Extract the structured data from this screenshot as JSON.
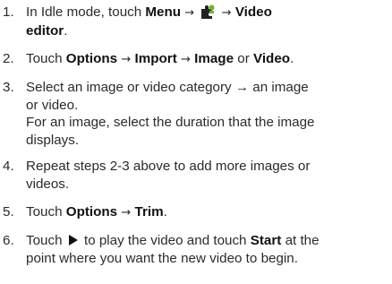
{
  "steps": [
    {
      "number": "1.",
      "line1_pre": "In Idle mode, touch ",
      "line1_b1": "Menu",
      "arrow": "→",
      "line1_b2": "Video",
      "line2_b": "editor",
      "line2_post": ".",
      "icon": "puzzle-piece-icon"
    },
    {
      "number": "2.",
      "pre": "Touch ",
      "b1": "Options",
      "arrow": "→",
      "b2": "Import",
      "b3": "Image",
      "mid": " or ",
      "b4": "Video",
      "post": "."
    },
    {
      "number": "3.",
      "line1": "Select an image or video category → an image",
      "line2": "or video.",
      "line3": "For an image, select the duration that the image",
      "line4": "displays."
    },
    {
      "number": "4.",
      "line1": "Repeat steps 2-3 above to add more images or",
      "line2": "videos."
    },
    {
      "number": "5.",
      "pre": "Touch ",
      "b1": "Options",
      "arrow": "→",
      "b2": "Trim",
      "post": "."
    },
    {
      "number": "6.",
      "line1_pre": "Touch ",
      "line1_mid": " to play the video and touch ",
      "line1_b": "Start",
      "line1_post": " at the",
      "line2": "point where you want the new video to begin.",
      "icon": "play-icon"
    }
  ],
  "colors": {
    "text": "#2b2b2b",
    "bold": "#111111",
    "puzzle_dark": "#222222",
    "puzzle_green": "#6fb02e",
    "play": "#111111"
  }
}
